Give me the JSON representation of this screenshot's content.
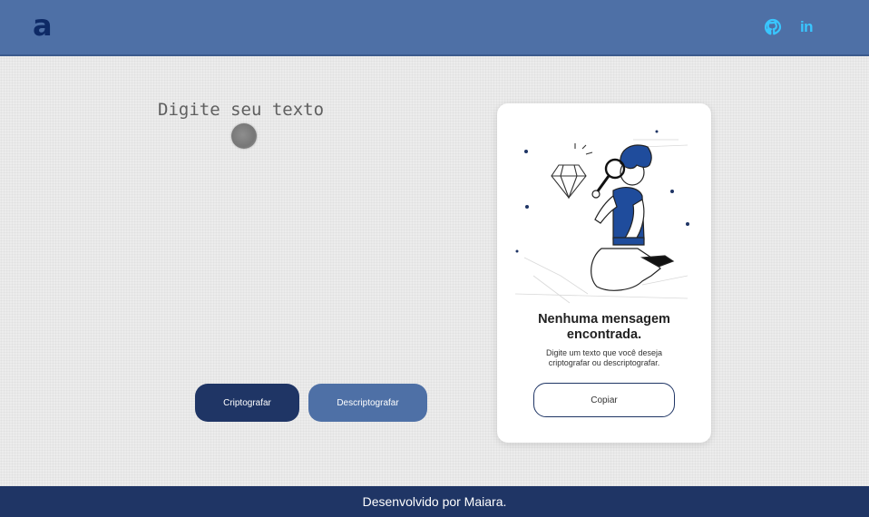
{
  "header": {
    "logo_text": "a",
    "github_icon": "github-icon",
    "linkedin_label": "in"
  },
  "input": {
    "placeholder": "Digite seu texto"
  },
  "buttons": {
    "encrypt_label": "Criptografar",
    "decrypt_label": "Descriptografar"
  },
  "output_card": {
    "title": "Nenhuma mensagem encontrada.",
    "subtitle": "Digite um texto que você deseja criptografar ou descriptografar.",
    "copy_label": "Copiar",
    "illustration": "person-with-magnifier-diamond-illustration"
  },
  "footer": {
    "text": "Desenvolvido por Maiara."
  },
  "colors": {
    "header_bg": "#4e70a6",
    "primary_dark": "#1f3565",
    "accent_icon": "#39c6ff"
  }
}
